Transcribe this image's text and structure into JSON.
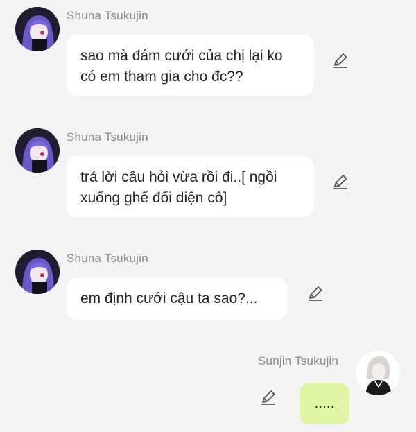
{
  "messages": [
    {
      "sender": "Shuna Tsukujin",
      "text": "sao mà đám cưới của chị lại ko có em tham gia cho đc??",
      "edit_icon": "pencil-icon"
    },
    {
      "sender": "Shuna Tsukujin",
      "text": "trả lời câu hỏi vừa rồi đi..[ ngồi xuống ghế đối diện cô]",
      "edit_icon": "pencil-icon"
    },
    {
      "sender": "Shuna Tsukujin",
      "text": "em định cưới cậu ta sao?...",
      "edit_icon": "pencil-icon"
    },
    {
      "sender": "Sunjin Tsukujin",
      "text": ".....",
      "edit_icon": "pencil-icon"
    }
  ],
  "colors": {
    "background": "#f3f3f3",
    "bubble_other": "#ffffff",
    "bubble_self": "#dff5a3",
    "name_text": "#8a8a8a"
  }
}
